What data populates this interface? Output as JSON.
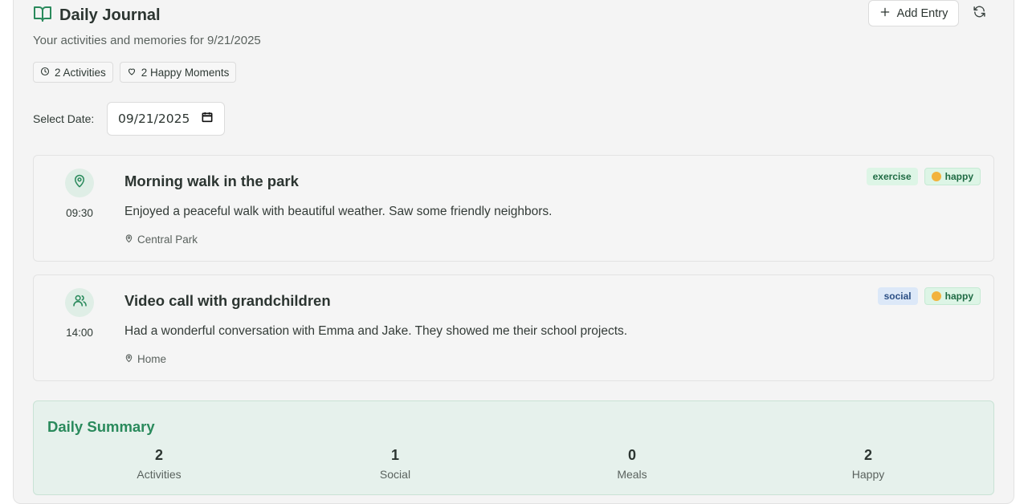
{
  "header": {
    "title": "Daily Journal",
    "subtitle": "Your activities and memories for 9/21/2025",
    "add_entry_label": "Add Entry"
  },
  "chips": {
    "activities": "2 Activities",
    "happy_moments": "2 Happy Moments"
  },
  "date_picker": {
    "label": "Select Date:",
    "value": "09/21/2025"
  },
  "entries": [
    {
      "icon": "map-pin-icon",
      "time": "09:30",
      "title": "Morning walk in the park",
      "description": "Enjoyed a peaceful walk with beautiful weather. Saw some friendly neighbors.",
      "location": "Central Park",
      "category": "exercise",
      "mood": "happy"
    },
    {
      "icon": "users-icon",
      "time": "14:00",
      "title": "Video call with grandchildren",
      "description": "Had a wonderful conversation with Emma and Jake. They showed me their school projects.",
      "location": "Home",
      "category": "social",
      "mood": "happy"
    }
  ],
  "summary": {
    "title": "Daily Summary",
    "stats": [
      {
        "value": "2",
        "label": "Activities"
      },
      {
        "value": "1",
        "label": "Social"
      },
      {
        "value": "0",
        "label": "Meals"
      },
      {
        "value": "2",
        "label": "Happy"
      }
    ]
  },
  "colors": {
    "accent_green": "#2a8a5c",
    "exercise_tag_bg": "#ddf5e6",
    "social_tag_bg": "#dce8f8"
  }
}
